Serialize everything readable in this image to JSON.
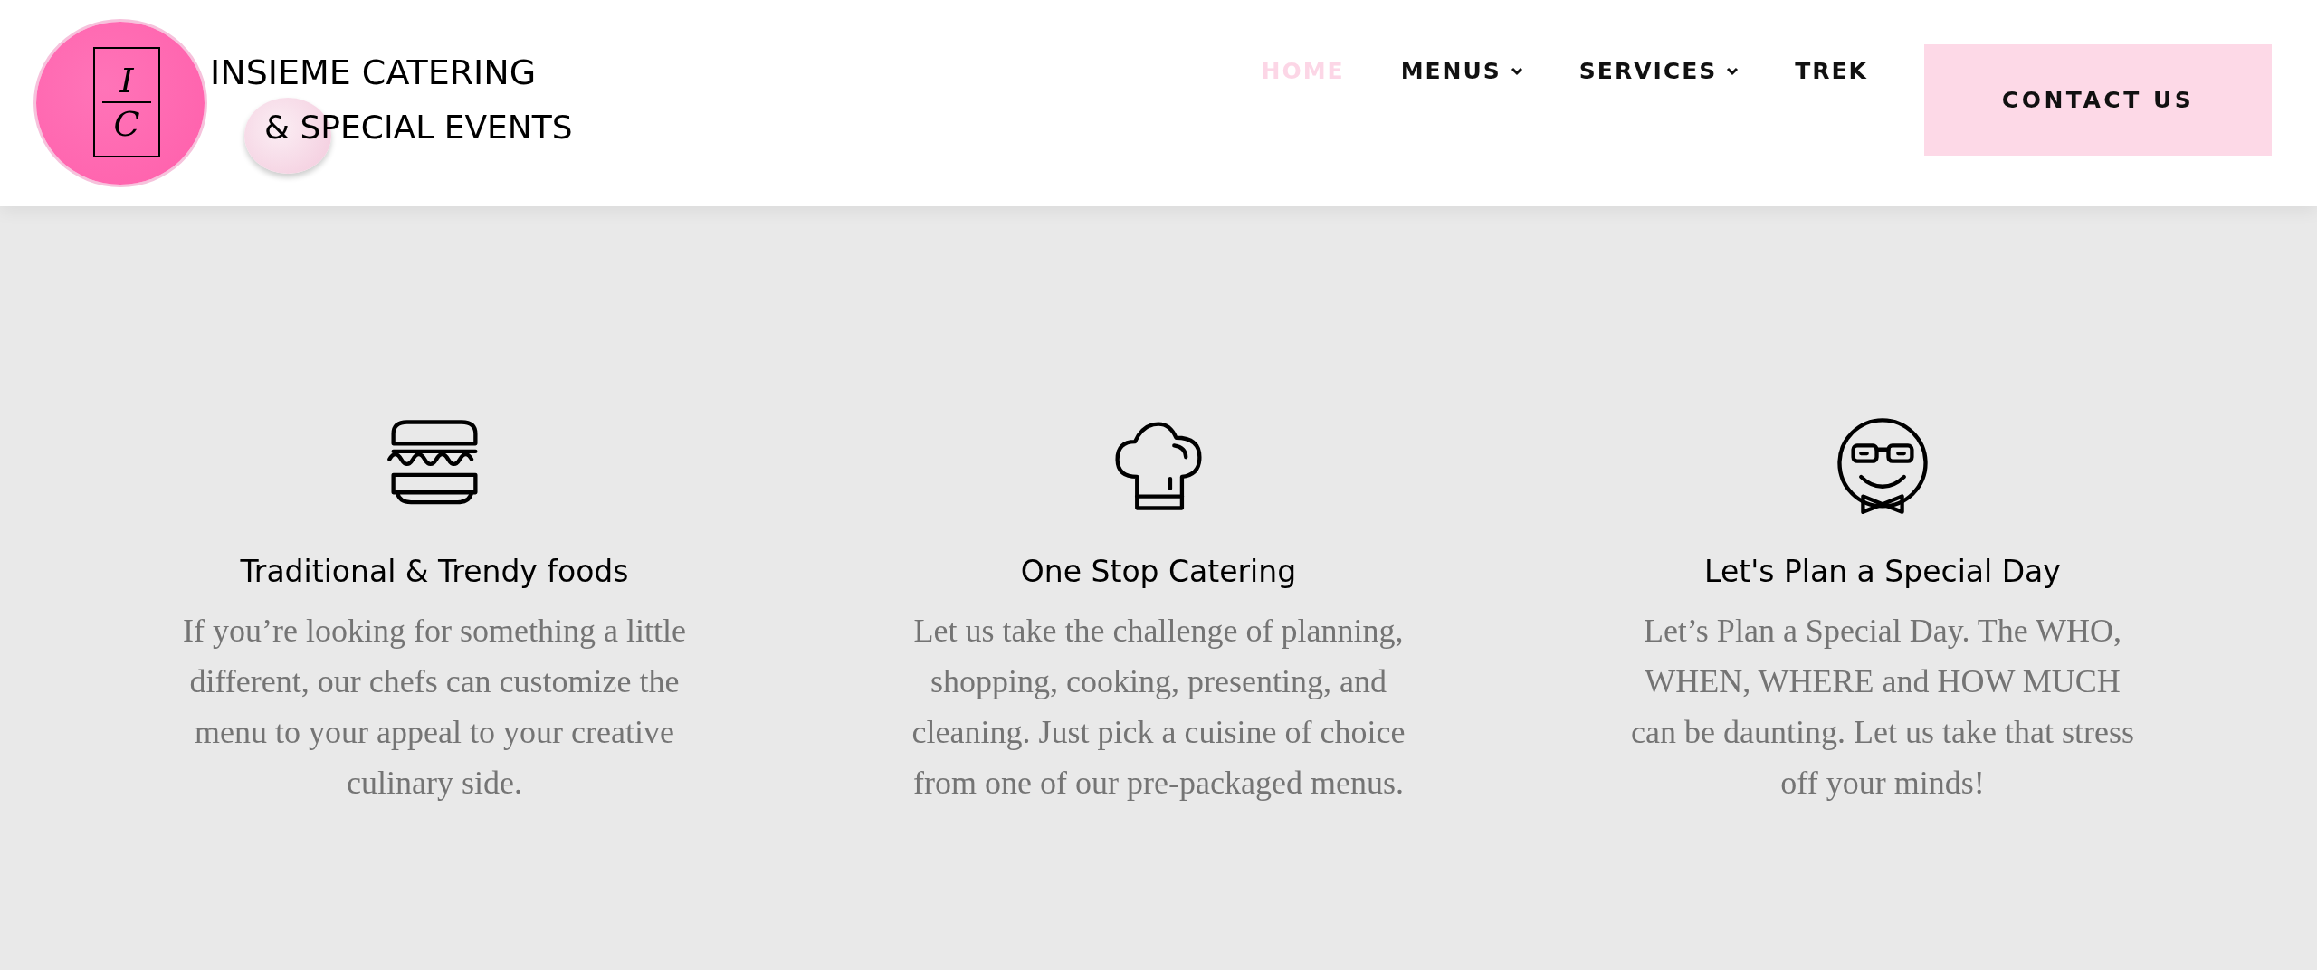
{
  "logo": {
    "initials_top": "I",
    "initials_bottom": "C",
    "line_1": "INSIEME CATERING",
    "line_2": "& SPECIAL EVENTS"
  },
  "nav": [
    {
      "label": "HOME",
      "selected": true,
      "dropdown": false
    },
    {
      "label": "MENUS",
      "selected": false,
      "dropdown": true
    },
    {
      "label": "SERVICES",
      "selected": false,
      "dropdown": true
    },
    {
      "label": "TREK",
      "selected": false,
      "dropdown": false
    }
  ],
  "cta": "CONTACT US",
  "features": [
    {
      "kind": "burger",
      "title": "Traditional & Trendy foods",
      "text": "If you’re looking for something a little different, our chefs can customize the menu to your appeal to your creative culinary side."
    },
    {
      "kind": "chef",
      "title": "One Stop Catering",
      "text": "Let us take the challenge of planning, shopping, cooking, presenting, and cleaning. Just pick a cuisine of choice from one of our pre-packaged menus."
    },
    {
      "kind": "smiley",
      "title": "Let's Plan a Special Day",
      "text": "Let’s Plan a Special Day. The WHO, WHEN, WHERE and HOW MUCH can be daunting. Let us take that stress off your minds!"
    }
  ]
}
